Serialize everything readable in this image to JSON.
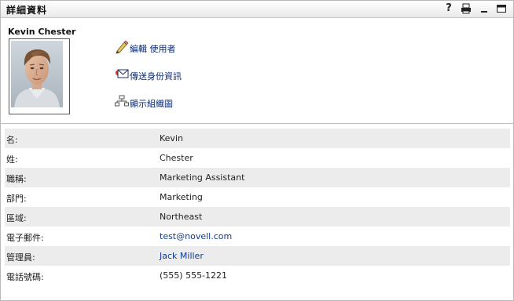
{
  "portlet": {
    "title": "詳細資料",
    "help_label": "?"
  },
  "user": {
    "name": "Kevin Chester"
  },
  "actions": [
    {
      "label": "編輯 使用者",
      "icon": "pencil-icon"
    },
    {
      "label": "傳送身份資訊",
      "icon": "envelope-icon"
    },
    {
      "label": "顯示組織圖",
      "icon": "org-chart-icon"
    }
  ],
  "details": [
    {
      "key": "名:",
      "value": "Kevin",
      "link": false
    },
    {
      "key": "姓:",
      "value": "Chester",
      "link": false
    },
    {
      "key": "職稱:",
      "value": "Marketing Assistant",
      "link": false
    },
    {
      "key": "部門:",
      "value": "Marketing",
      "link": false
    },
    {
      "key": "區域:",
      "value": "Northeast",
      "link": false
    },
    {
      "key": "電子郵件:",
      "value": "test@novell.com",
      "link": true
    },
    {
      "key": "管理員:",
      "value": "Jack Miller",
      "link": true
    },
    {
      "key": "電話號碼:",
      "value": "(555) 555-1221",
      "link": false
    }
  ],
  "colors": {
    "link": "#123c8c",
    "row_alt": "#ececec",
    "titlebar_end": "#eaeaea"
  }
}
